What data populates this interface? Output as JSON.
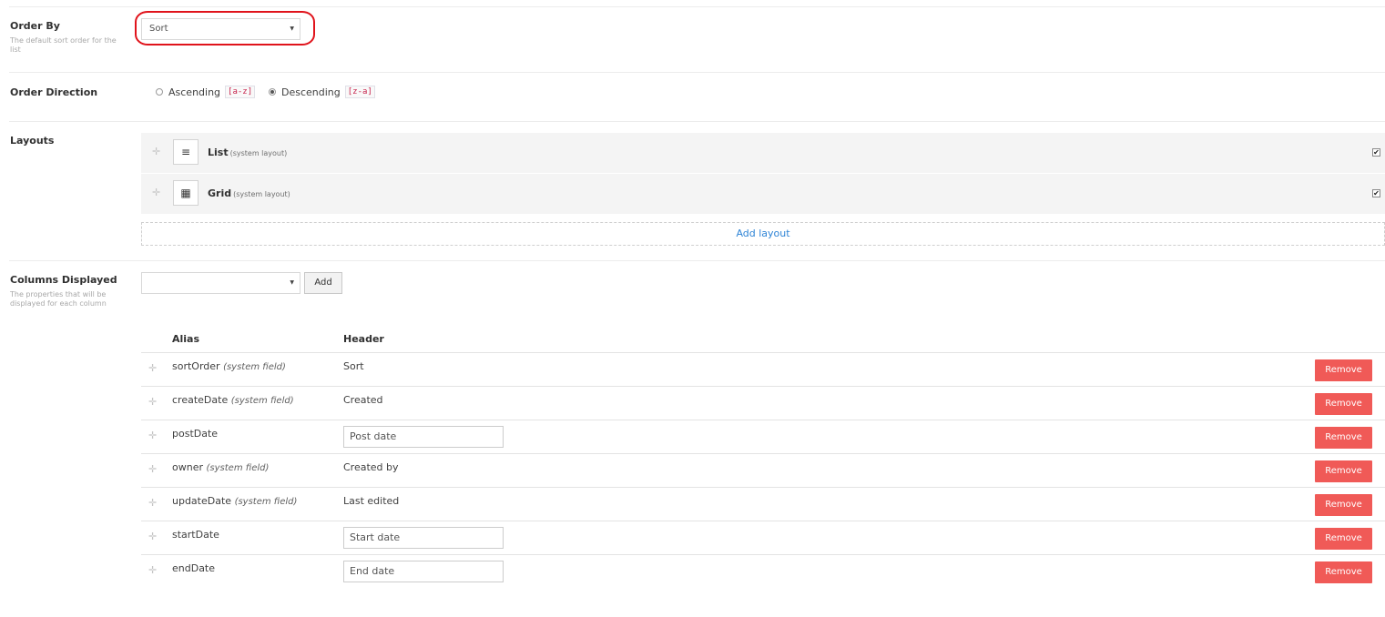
{
  "order_by": {
    "label": "Order By",
    "description": "The default sort order for the list",
    "selected": "Sort",
    "caret": "▼"
  },
  "order_direction": {
    "label": "Order Direction",
    "ascending_label": "Ascending",
    "ascending_code": "[a-z]",
    "descending_label": "Descending",
    "descending_code": "[z-a]",
    "selected": "Descending"
  },
  "layouts": {
    "label": "Layouts",
    "items": [
      {
        "name": "List",
        "sub": "(system layout)",
        "icon": "list-icon",
        "glyph": "≡",
        "checked": true
      },
      {
        "name": "Grid",
        "sub": "(system layout)",
        "icon": "grid-icon",
        "glyph": "▦",
        "checked": true
      }
    ],
    "add_label": "Add layout",
    "check_glyph": "✔",
    "handle_glyph": "✛"
  },
  "columns": {
    "label": "Columns Displayed",
    "description": "The properties that will be displayed for each column",
    "add_label": "Add",
    "caret": "▼",
    "headers": {
      "alias": "Alias",
      "header": "Header"
    },
    "remove_label": "Remove",
    "rows": [
      {
        "alias": "sortOrder",
        "system": "(system field)",
        "header": "Sort",
        "editable": false
      },
      {
        "alias": "createDate",
        "system": "(system field)",
        "header": "Created",
        "editable": false
      },
      {
        "alias": "postDate",
        "system": "",
        "header": "Post date",
        "editable": true
      },
      {
        "alias": "owner",
        "system": "(system field)",
        "header": "Created by",
        "editable": false
      },
      {
        "alias": "updateDate",
        "system": "(system field)",
        "header": "Last edited",
        "editable": false
      },
      {
        "alias": "startDate",
        "system": "",
        "header": "Start date",
        "editable": true
      },
      {
        "alias": "endDate",
        "system": "",
        "header": "End date",
        "editable": true
      }
    ]
  },
  "colors": {
    "remove": "#f05a57",
    "link": "#2e84d6",
    "highlight": "#e0131b"
  }
}
